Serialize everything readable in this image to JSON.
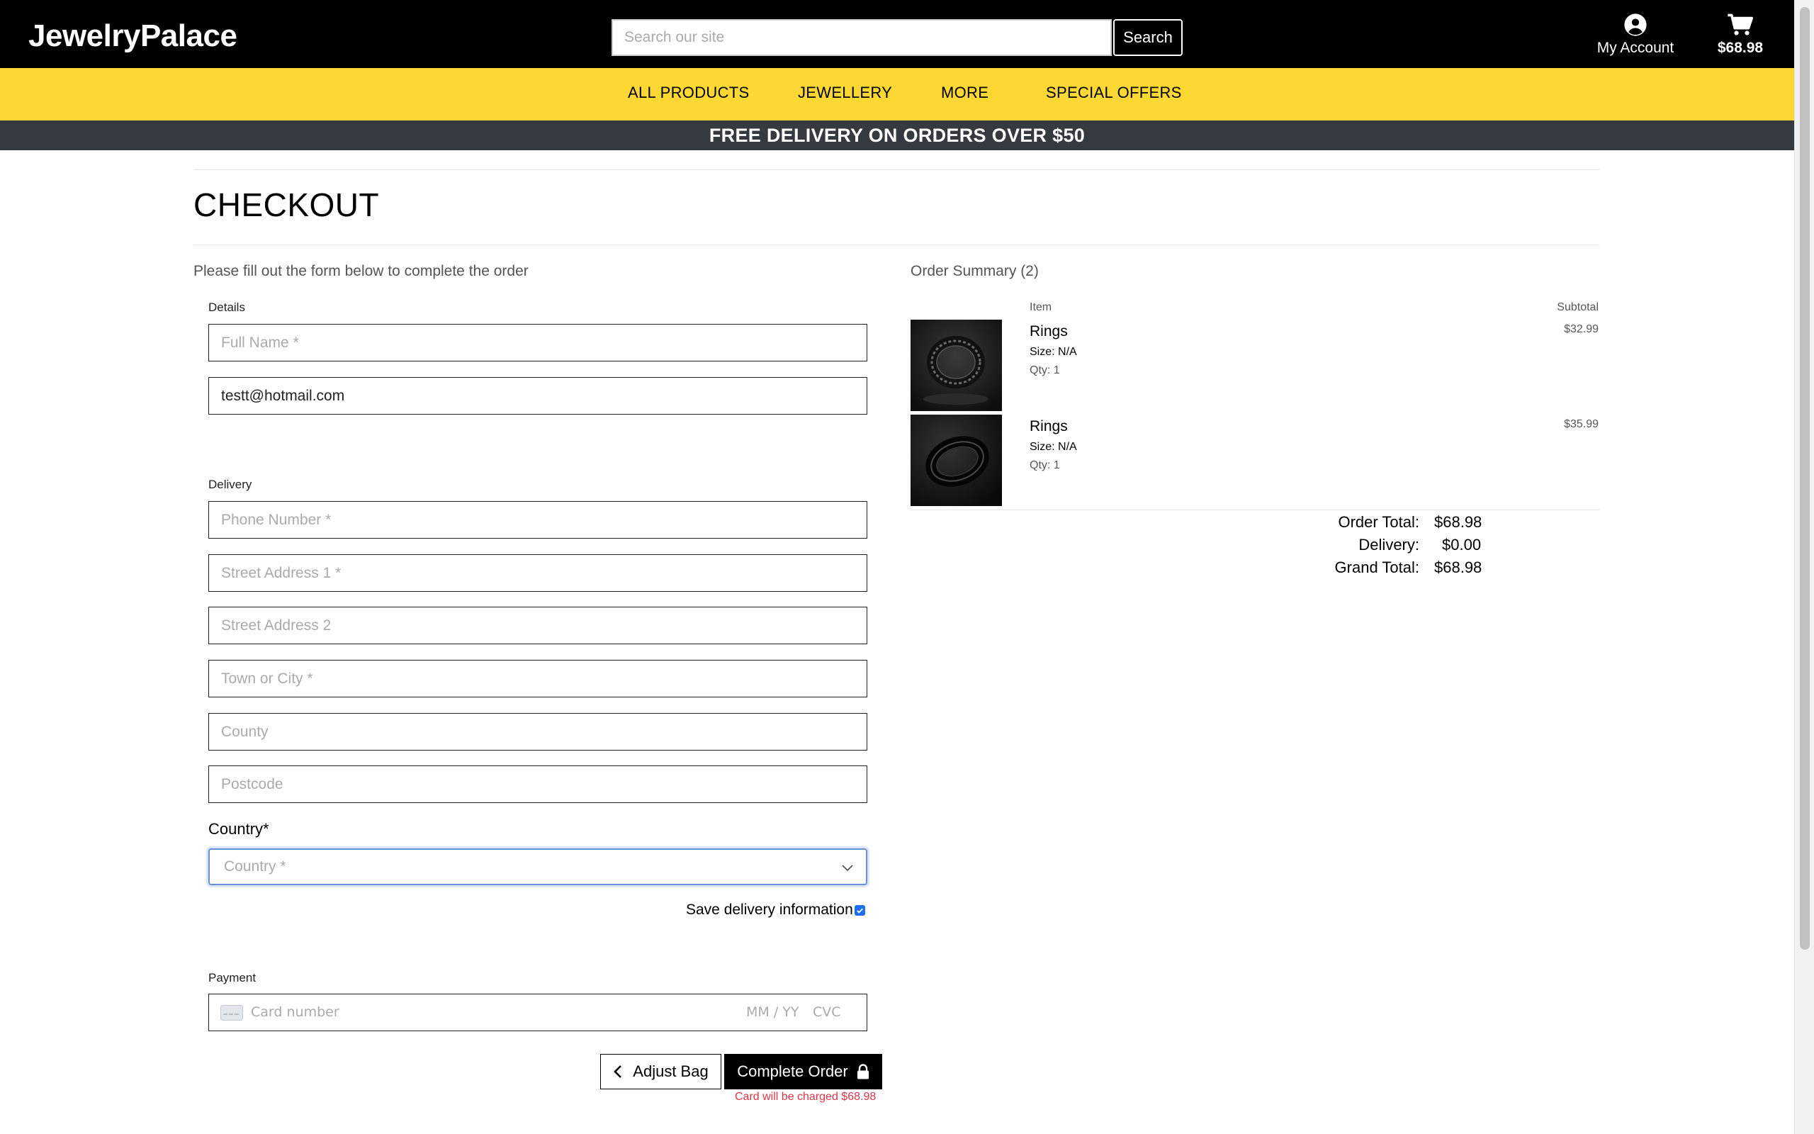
{
  "header": {
    "logo": "JewelryPalace",
    "search_placeholder": "Search our site",
    "search_button": "Search",
    "account_label": "My Account",
    "cart_total": "$68.98"
  },
  "nav": {
    "items": [
      "ALL PRODUCTS",
      "JEWELLERY",
      "MORE",
      "SPECIAL OFFERS"
    ]
  },
  "banner": "FREE DELIVERY ON ORDERS OVER $50",
  "checkout": {
    "title": "CHECKOUT",
    "intro": "Please fill out the form below to complete the order",
    "details_label": "Details",
    "full_name_placeholder": "Full Name *",
    "email_value": "testt@hotmail.com",
    "delivery_label": "Delivery",
    "phone_placeholder": "Phone Number *",
    "street1_placeholder": "Street Address 1 *",
    "street2_placeholder": "Street Address 2",
    "town_placeholder": "Town or City *",
    "county_placeholder": "County",
    "postcode_placeholder": "Postcode",
    "country_label": "Country*",
    "country_placeholder": "Country *",
    "save_delivery_label": "Save delivery information",
    "save_delivery_checked": true,
    "payment_label": "Payment",
    "card_number_placeholder": "Card number",
    "card_expiry_placeholder": "MM / YY",
    "card_cvc_placeholder": "CVC",
    "adjust_bag_button": "Adjust Bag",
    "complete_order_button": "Complete Order",
    "charge_note": "Card will be charged $68.98"
  },
  "summary": {
    "title": "Order Summary (2)",
    "col_item": "Item",
    "col_subtotal": "Subtotal",
    "items": [
      {
        "name": "Rings",
        "size": "Size: N/A",
        "qty": "Qty: 1",
        "subtotal": "$32.99"
      },
      {
        "name": "Rings",
        "size": "Size: N/A",
        "qty": "Qty: 1",
        "subtotal": "$35.99"
      }
    ],
    "order_total_label": "Order Total:",
    "order_total_value": "$68.98",
    "delivery_label": "Delivery:",
    "delivery_value": "$0.00",
    "grand_total_label": "Grand Total:",
    "grand_total_value": "$68.98"
  },
  "colors": {
    "nav_bg": "#fdd835",
    "banner_bg": "#353a40",
    "charge_note": "#dc3545"
  }
}
